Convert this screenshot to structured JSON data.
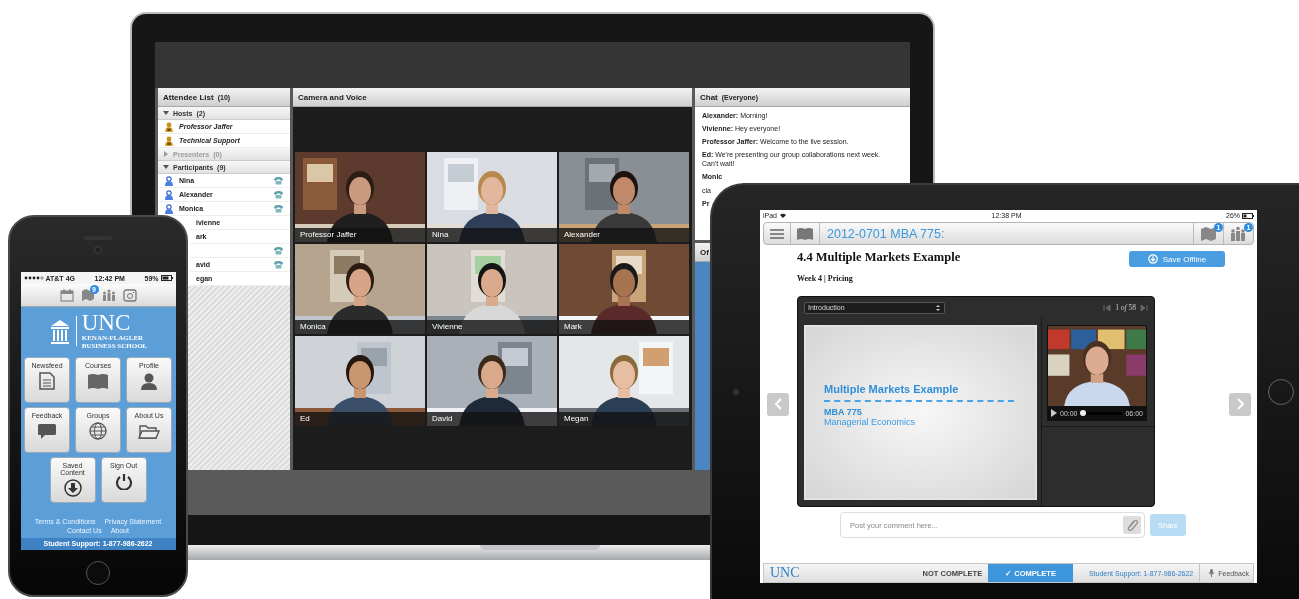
{
  "laptop": {
    "attendee_list": {
      "title": "Attendee List",
      "count": "(10)",
      "groups": [
        {
          "label": "Hosts",
          "count": "(2)",
          "expanded": true,
          "disabled": false,
          "members": [
            {
              "name": "Professor Jaffer",
              "kind": "host",
              "phone": false
            },
            {
              "name": "Technical Support",
              "kind": "host",
              "phone": false
            }
          ]
        },
        {
          "label": "Presenters",
          "count": "(0)",
          "expanded": false,
          "disabled": true
        },
        {
          "label": "Participants",
          "count": "(9)",
          "expanded": true,
          "disabled": false,
          "members": [
            {
              "name": "Nina",
              "kind": "participant",
              "phone": true
            },
            {
              "name": "Alexander",
              "kind": "participant",
              "phone": true
            },
            {
              "name": "Monica",
              "kind": "participant",
              "phone": true
            },
            {
              "name": "ivienne",
              "phone": false
            },
            {
              "name": "ark",
              "phone": false
            },
            {
              "phone": true
            },
            {
              "name": "avid",
              "phone": true
            },
            {
              "name": "egan",
              "phone": false
            }
          ]
        }
      ]
    },
    "camera": {
      "title": "Camera and Voice",
      "tiles": [
        {
          "name": "Professor Jaffer"
        },
        {
          "name": "Nina"
        },
        {
          "name": "Alexander"
        },
        {
          "name": "Monica"
        },
        {
          "name": "Vivienne"
        },
        {
          "name": "Mark"
        },
        {
          "name": "Ed"
        },
        {
          "name": "David"
        },
        {
          "name": "Megan"
        }
      ]
    },
    "chat": {
      "title": "Chat",
      "scope": "(Everyone)",
      "messages": [
        {
          "text": "**Alexander:** Morning!",
          "bold": false
        },
        {
          "text": "**Vivienne:** Hey everyone!",
          "bold": false
        },
        {
          "text": "**Professor Jaffer:** Welcome to the live session.",
          "bold": false
        },
        {
          "text": "**Ed:** We're presenting our group collaborations next week. Can't wait!",
          "bold": false
        },
        {
          "text": "Monic",
          "bold": true
        },
        {
          "text": "cla",
          "bold": false
        },
        {
          "text": "Pr",
          "bold": true
        }
      ]
    },
    "side_panel": {
      "title": "Of"
    }
  },
  "phone": {
    "status": {
      "carrier": "AT&T",
      "network": "4G",
      "time": "12:42 PM",
      "battery": "59%"
    },
    "toolbar_badge": "9",
    "logo": {
      "wordmark": "UNC",
      "line1": "KENAN-FLAGLER",
      "line2": "BUSINESS SCHOOL"
    },
    "tiles": [
      {
        "label": "Newsfeed",
        "kind": "newsfeed"
      },
      {
        "label": "Courses",
        "kind": "courses"
      },
      {
        "label": "Profile",
        "kind": "profile"
      },
      {
        "label": "Feedback",
        "kind": "feedback"
      },
      {
        "label": "Groups",
        "kind": "groups"
      },
      {
        "label": "About Us",
        "kind": "about"
      },
      {
        "label": "Saved Content",
        "kind": "saved"
      },
      {
        "label": "Sign Out",
        "kind": "signout"
      }
    ],
    "links": [
      "Terms & Conditions",
      "Privacy Statement",
      "Contact Us",
      "About"
    ],
    "support": "Student Support: 1-877-986-2622"
  },
  "tablet": {
    "status": {
      "device": "iPad",
      "time": "12:38 PM",
      "battery": "26%"
    },
    "toolbar": {
      "title": "2012-0701 MBA 775:",
      "badges": [
        "1",
        "1"
      ]
    },
    "heading": "4.4 Multiple Markets Example",
    "subheading": "Week 4 | Pricing",
    "save_button": "Save Offline",
    "player": {
      "section": "Introduction",
      "pager": "1 *of* 58",
      "slide": {
        "title": "Multiple Markets Example",
        "course": "MBA 775",
        "subtitle": "Managerial Economics"
      },
      "video": {
        "elapsed": "00:00",
        "duration": "06:00",
        "level": 0
      }
    },
    "comment": {
      "placeholder": "Post your comment here...",
      "share": {
        "label": "Share",
        "disabled": true
      }
    },
    "footer": {
      "logo": "UNC",
      "status": [
        {
          "label": "NOT COMPLETE",
          "selected": false
        },
        {
          "label": "✓ COMPLETE",
          "selected": true
        }
      ],
      "support": "Student Support: 1-877-986-2622",
      "feedback": "Feedback"
    }
  }
}
